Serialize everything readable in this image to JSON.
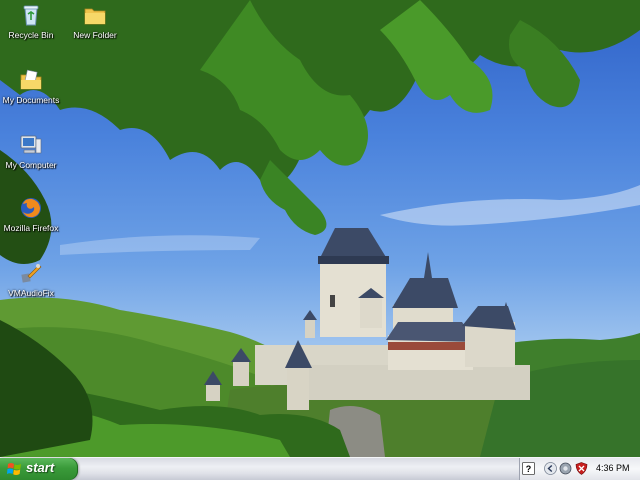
{
  "desktop": {
    "icons": [
      {
        "id": "recycle-bin",
        "label": "Recycle Bin"
      },
      {
        "id": "new-folder",
        "label": "New Folder"
      },
      {
        "id": "my-documents",
        "label": "My Documents"
      },
      {
        "id": "my-computer",
        "label": "My Computer"
      },
      {
        "id": "mozilla-firefox",
        "label": "Mozilla Firefox"
      },
      {
        "id": "vmaudiofix",
        "label": "VMAudioFix"
      }
    ]
  },
  "taskbar": {
    "start_label": "start",
    "tray": {
      "clock": "4:36 PM",
      "icons": [
        "help-icon",
        "expand-tray-arrow-icon",
        "network-icon",
        "security-shield-icon"
      ]
    }
  },
  "colors": {
    "start_green": "#3a9b3a",
    "taskbar": "#dfe1e8",
    "sky": "#4a82dc"
  }
}
